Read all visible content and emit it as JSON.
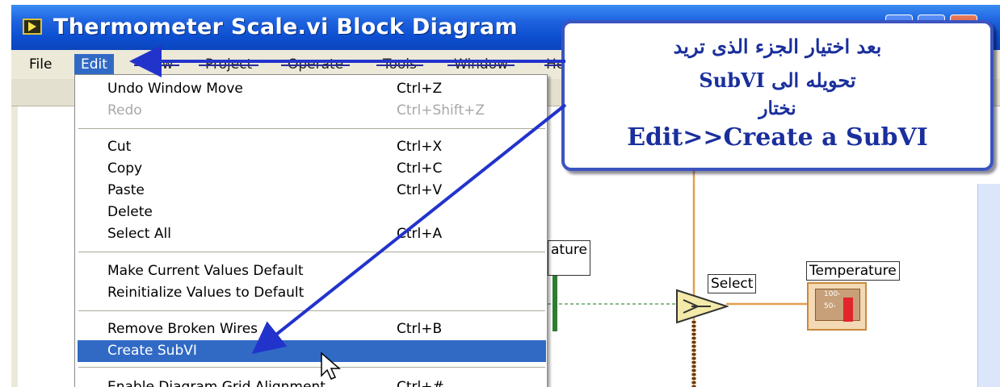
{
  "window": {
    "title": "Thermometer Scale.vi Block Diagram"
  },
  "menubar": {
    "items": [
      "File",
      "Edit",
      "View",
      "Project",
      "Operate",
      "Tools",
      "Window",
      "Help"
    ]
  },
  "edit_menu": {
    "items": [
      {
        "label": "Undo Window Move",
        "shortcut": "Ctrl+Z",
        "enabled": true
      },
      {
        "label": "Redo",
        "shortcut": "Ctrl+Shift+Z",
        "enabled": false
      },
      {
        "label": "Cut",
        "shortcut": "Ctrl+X",
        "enabled": true
      },
      {
        "label": "Copy",
        "shortcut": "Ctrl+C",
        "enabled": true
      },
      {
        "label": "Paste",
        "shortcut": "Ctrl+V",
        "enabled": true
      },
      {
        "label": "Delete",
        "shortcut": "",
        "enabled": true
      },
      {
        "label": "Select All",
        "shortcut": "Ctrl+A",
        "enabled": true
      },
      {
        "label": "Make Current Values Default",
        "shortcut": "",
        "enabled": true
      },
      {
        "label": "Reinitialize Values to Default",
        "shortcut": "",
        "enabled": true
      },
      {
        "label": "Remove Broken Wires",
        "shortcut": "Ctrl+B",
        "enabled": true
      },
      {
        "label": "Create SubVI",
        "shortcut": "",
        "enabled": true,
        "highlighted": true
      },
      {
        "label": "Enable Diagram Grid Alignment",
        "shortcut": "Ctrl+#",
        "enabled": true
      }
    ]
  },
  "callout": {
    "line1": "بعد اختيار الجزء الذى تريد",
    "line2": "تحويله الى SubVI",
    "line3": "نختار",
    "line4": "Edit>>Create a SubVI"
  },
  "diagram": {
    "control_label_partial": "ature",
    "select_label": "Select",
    "indicator_label": "Temperature",
    "indicator_ticks": [
      "100-",
      "50-"
    ]
  },
  "colors": {
    "title_bar": "#0d4fd1",
    "menu_highlight": "#316ac5",
    "callout_border": "#3b54c0",
    "callout_text": "#1a2f9c",
    "wire_orange": "#e0a050",
    "wire_brown": "#6b3a12",
    "annotation_arrow": "#2233cc"
  }
}
